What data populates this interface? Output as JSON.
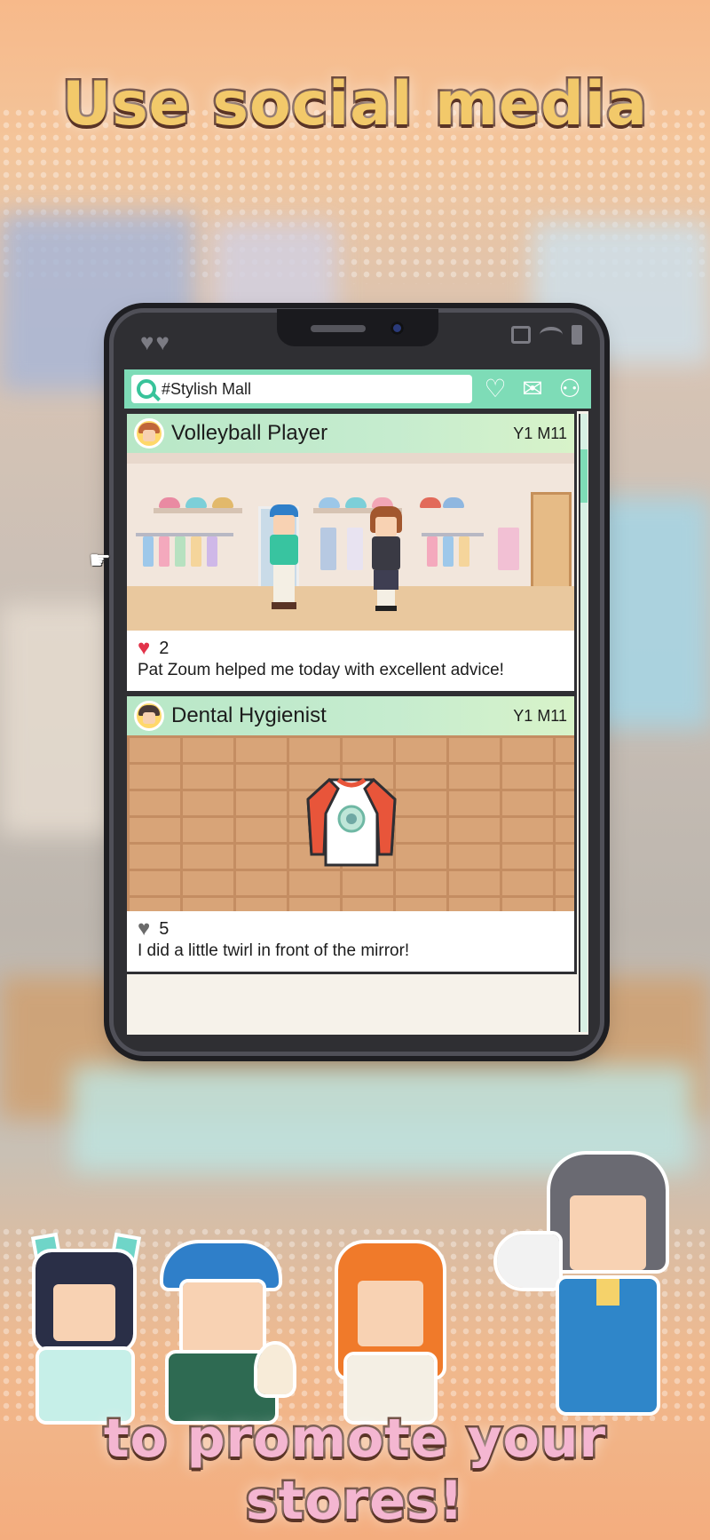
{
  "banner": {
    "top_text": "Use social media",
    "bottom_text": "to promote your stores!"
  },
  "phone": {
    "status_left": "♥♥",
    "search": {
      "query": "#Stylish Mall"
    },
    "actions": [
      "heart-icon",
      "mail-icon",
      "profile-icon"
    ]
  },
  "posts": [
    {
      "author": "Volleyball Player",
      "date": "Y1 M11",
      "likes": "2",
      "liked": true,
      "text": "Pat Zoum helped me today with excellent advice!"
    },
    {
      "author": "Dental Hygienist",
      "date": "Y1 M11",
      "likes": "5",
      "liked": false,
      "text": "I did a little twirl in front of the mirror!"
    }
  ],
  "colors": {
    "accent": "#7edcb7",
    "like_active": "#e2334a",
    "like_inactive": "#6a6a6a",
    "title_fill": "#f2c96a",
    "bottom_fill": "#f4b6d1"
  }
}
